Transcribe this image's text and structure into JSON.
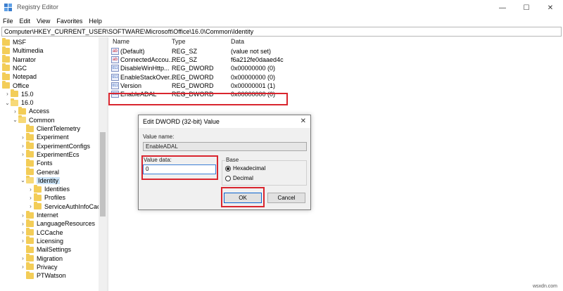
{
  "window": {
    "title": "Registry Editor",
    "min": "—",
    "max": "☐",
    "close": "✕"
  },
  "menu": [
    "File",
    "Edit",
    "View",
    "Favorites",
    "Help"
  ],
  "address": "Computer\\HKEY_CURRENT_USER\\SOFTWARE\\Microsoft\\Office\\16.0\\Common\\Identity",
  "tree": [
    {
      "label": "MSF",
      "level": 0,
      "chev": ""
    },
    {
      "label": "Multimedia",
      "level": 0,
      "chev": ""
    },
    {
      "label": "Narrator",
      "level": 0,
      "chev": ""
    },
    {
      "label": "NGC",
      "level": 0,
      "chev": ""
    },
    {
      "label": "Notepad",
      "level": 0,
      "chev": ""
    },
    {
      "label": "Office",
      "level": 0,
      "chev": ""
    },
    {
      "label": "15.0",
      "level": 1,
      "chev": "›"
    },
    {
      "label": "16.0",
      "level": 1,
      "chev": "⌄"
    },
    {
      "label": "Access",
      "level": 2,
      "chev": "›"
    },
    {
      "label": "Common",
      "level": 2,
      "chev": "⌄"
    },
    {
      "label": "ClientTelemetry",
      "level": 3,
      "chev": ""
    },
    {
      "label": "Experiment",
      "level": 3,
      "chev": "›"
    },
    {
      "label": "ExperimentConfigs",
      "level": 3,
      "chev": "›"
    },
    {
      "label": "ExperimentEcs",
      "level": 3,
      "chev": "›"
    },
    {
      "label": "Fonts",
      "level": 3,
      "chev": ""
    },
    {
      "label": "General",
      "level": 3,
      "chev": ""
    },
    {
      "label": "Identity",
      "level": 3,
      "chev": "⌄",
      "selected": true
    },
    {
      "label": "Identities",
      "level": 4,
      "chev": "›"
    },
    {
      "label": "Profiles",
      "level": 4,
      "chev": "›"
    },
    {
      "label": "ServiceAuthInfoCache",
      "level": 4,
      "chev": "›"
    },
    {
      "label": "Internet",
      "level": 3,
      "chev": "›"
    },
    {
      "label": "LanguageResources",
      "level": 3,
      "chev": "›"
    },
    {
      "label": "LCCache",
      "level": 3,
      "chev": "›"
    },
    {
      "label": "Licensing",
      "level": 3,
      "chev": "›"
    },
    {
      "label": "MailSettings",
      "level": 3,
      "chev": ""
    },
    {
      "label": "Migration",
      "level": 3,
      "chev": "›"
    },
    {
      "label": "Privacy",
      "level": 3,
      "chev": "›"
    },
    {
      "label": "PTWatson",
      "level": 3,
      "chev": ""
    }
  ],
  "columns": {
    "name": "Name",
    "type": "Type",
    "data": "Data"
  },
  "values": [
    {
      "name": "(Default)",
      "type": "REG_SZ",
      "data": "(value not set)",
      "icon": "ab"
    },
    {
      "name": "ConnectedAccou...",
      "type": "REG_SZ",
      "data": "f6a212fe0daaed4c",
      "icon": "ab"
    },
    {
      "name": "DisableWinHttp...",
      "type": "REG_DWORD",
      "data": "0x00000000 (0)",
      "icon": "bin"
    },
    {
      "name": "EnableStackOver...",
      "type": "REG_DWORD",
      "data": "0x00000000 (0)",
      "icon": "bin"
    },
    {
      "name": "Version",
      "type": "REG_DWORD",
      "data": "0x00000001 (1)",
      "icon": "bin"
    },
    {
      "name": "EnableADAL",
      "type": "REG_DWORD",
      "data": "0x00000000 (0)",
      "icon": "bin"
    }
  ],
  "dialog": {
    "title": "Edit DWORD (32-bit) Value",
    "close": "✕",
    "value_name_label": "Value name:",
    "value_name": "EnableADAL",
    "value_data_label": "Value data:",
    "value_data": "0",
    "base_label": "Base",
    "hex_label": "Hexadecimal",
    "dec_label": "Decimal",
    "ok": "OK",
    "cancel": "Cancel"
  },
  "watermark": "wsxdn.com",
  "colors": {
    "highlight": "#d9252e",
    "selection": "#cce4f7",
    "folder": "#f3cd58"
  }
}
